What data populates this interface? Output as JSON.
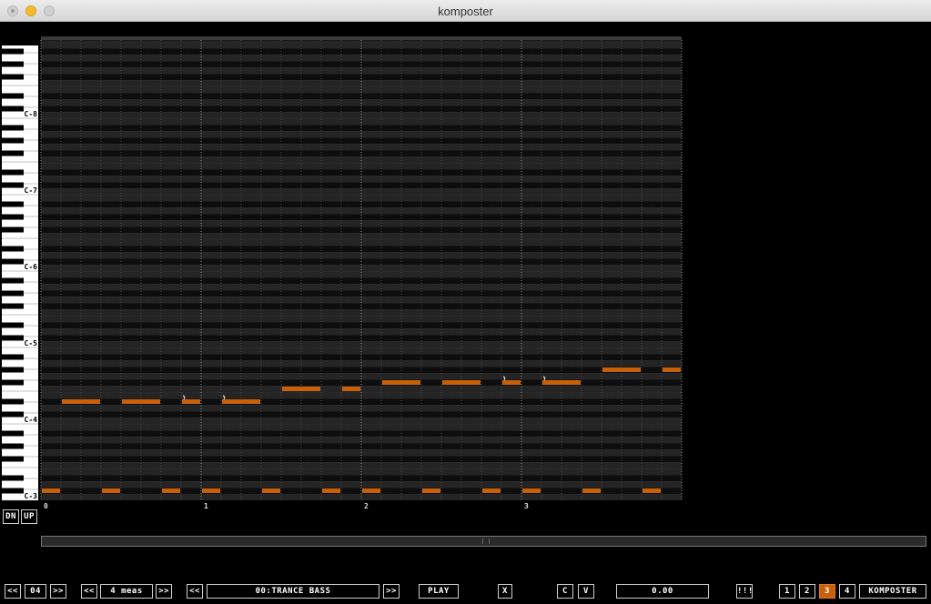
{
  "window": {
    "title": "komposter"
  },
  "piano": {
    "octave_labels": [
      "C-8",
      "C-7",
      "C-6",
      "C-5",
      "C-4",
      "C-3"
    ]
  },
  "timeline": {
    "measure_labels": [
      "0",
      "1",
      "2",
      "3"
    ]
  },
  "side_buttons": {
    "dn": "DN",
    "up": "UP"
  },
  "notes": [
    {
      "measure": 0,
      "beat": 1.0,
      "length": 2.0,
      "pitch": "D#4"
    },
    {
      "measure": 0,
      "beat": 4.0,
      "length": 2.0,
      "pitch": "D#4"
    },
    {
      "measure": 0,
      "beat": 7.0,
      "length": 1.0,
      "pitch": "D#4"
    },
    {
      "measure": 0,
      "beat": 9.0,
      "length": 2.0,
      "pitch": "D#4"
    },
    {
      "measure": 1,
      "beat": 4.0,
      "length": 2.0,
      "pitch": "F4"
    },
    {
      "measure": 1,
      "beat": 7.0,
      "length": 1.0,
      "pitch": "F4"
    },
    {
      "measure": 2,
      "beat": 1.0,
      "length": 2.0,
      "pitch": "F#4"
    },
    {
      "measure": 2,
      "beat": 4.0,
      "length": 2.0,
      "pitch": "F#4"
    },
    {
      "measure": 2,
      "beat": 7.0,
      "length": 1.0,
      "pitch": "F#4"
    },
    {
      "measure": 2,
      "beat": 9.0,
      "length": 2.0,
      "pitch": "F#4"
    },
    {
      "measure": 3,
      "beat": 4.0,
      "length": 2.0,
      "pitch": "G#4"
    },
    {
      "measure": 3,
      "beat": 7.0,
      "length": 1.0,
      "pitch": "G#4"
    },
    {
      "measure": 0,
      "beat": 0.0,
      "length": 1.0,
      "pitch": "C#3"
    },
    {
      "measure": 0,
      "beat": 3.0,
      "length": 1.0,
      "pitch": "C#3"
    },
    {
      "measure": 0,
      "beat": 6.0,
      "length": 1.0,
      "pitch": "C#3"
    },
    {
      "measure": 0,
      "beat": 8.0,
      "length": 1.0,
      "pitch": "C#3"
    },
    {
      "measure": 1,
      "beat": 3.0,
      "length": 1.0,
      "pitch": "C#3"
    },
    {
      "measure": 1,
      "beat": 6.0,
      "length": 1.0,
      "pitch": "C#3"
    },
    {
      "measure": 2,
      "beat": 0.0,
      "length": 1.0,
      "pitch": "C#3"
    },
    {
      "measure": 2,
      "beat": 3.0,
      "length": 1.0,
      "pitch": "C#3"
    },
    {
      "measure": 2,
      "beat": 6.0,
      "length": 1.0,
      "pitch": "C#3"
    },
    {
      "measure": 2,
      "beat": 8.0,
      "length": 1.0,
      "pitch": "C#3"
    },
    {
      "measure": 3,
      "beat": 3.0,
      "length": 1.0,
      "pitch": "C#3"
    },
    {
      "measure": 3,
      "beat": 6.0,
      "length": 1.0,
      "pitch": "C#3"
    }
  ],
  "note_markers": [
    {
      "measure": 0,
      "beat": 7.0,
      "pitch": "D#4"
    },
    {
      "measure": 0,
      "beat": 9.0,
      "pitch": "D#4"
    },
    {
      "measure": 2,
      "beat": 7.0,
      "pitch": "F#4"
    },
    {
      "measure": 2,
      "beat": 9.0,
      "pitch": "F#4"
    }
  ],
  "toolbar": {
    "pattern_prev": "<<",
    "pattern_num": "04",
    "pattern_next": ">>",
    "len_prev": "<<",
    "length": "4 meas",
    "len_next": ">>",
    "inst_prev": "<<",
    "instrument": "00:TRANCE BASS",
    "inst_next": ">>",
    "play": "PLAY",
    "x": "X",
    "c": "C",
    "v": "V",
    "value": "0.00",
    "grid": "!!!",
    "page1": "1",
    "page2": "2",
    "page3": "3",
    "page4": "4",
    "app": "KOMPOSTER"
  },
  "colors": {
    "note": "#c8600a",
    "accent_active": "#c8600a",
    "background": "#000000"
  }
}
